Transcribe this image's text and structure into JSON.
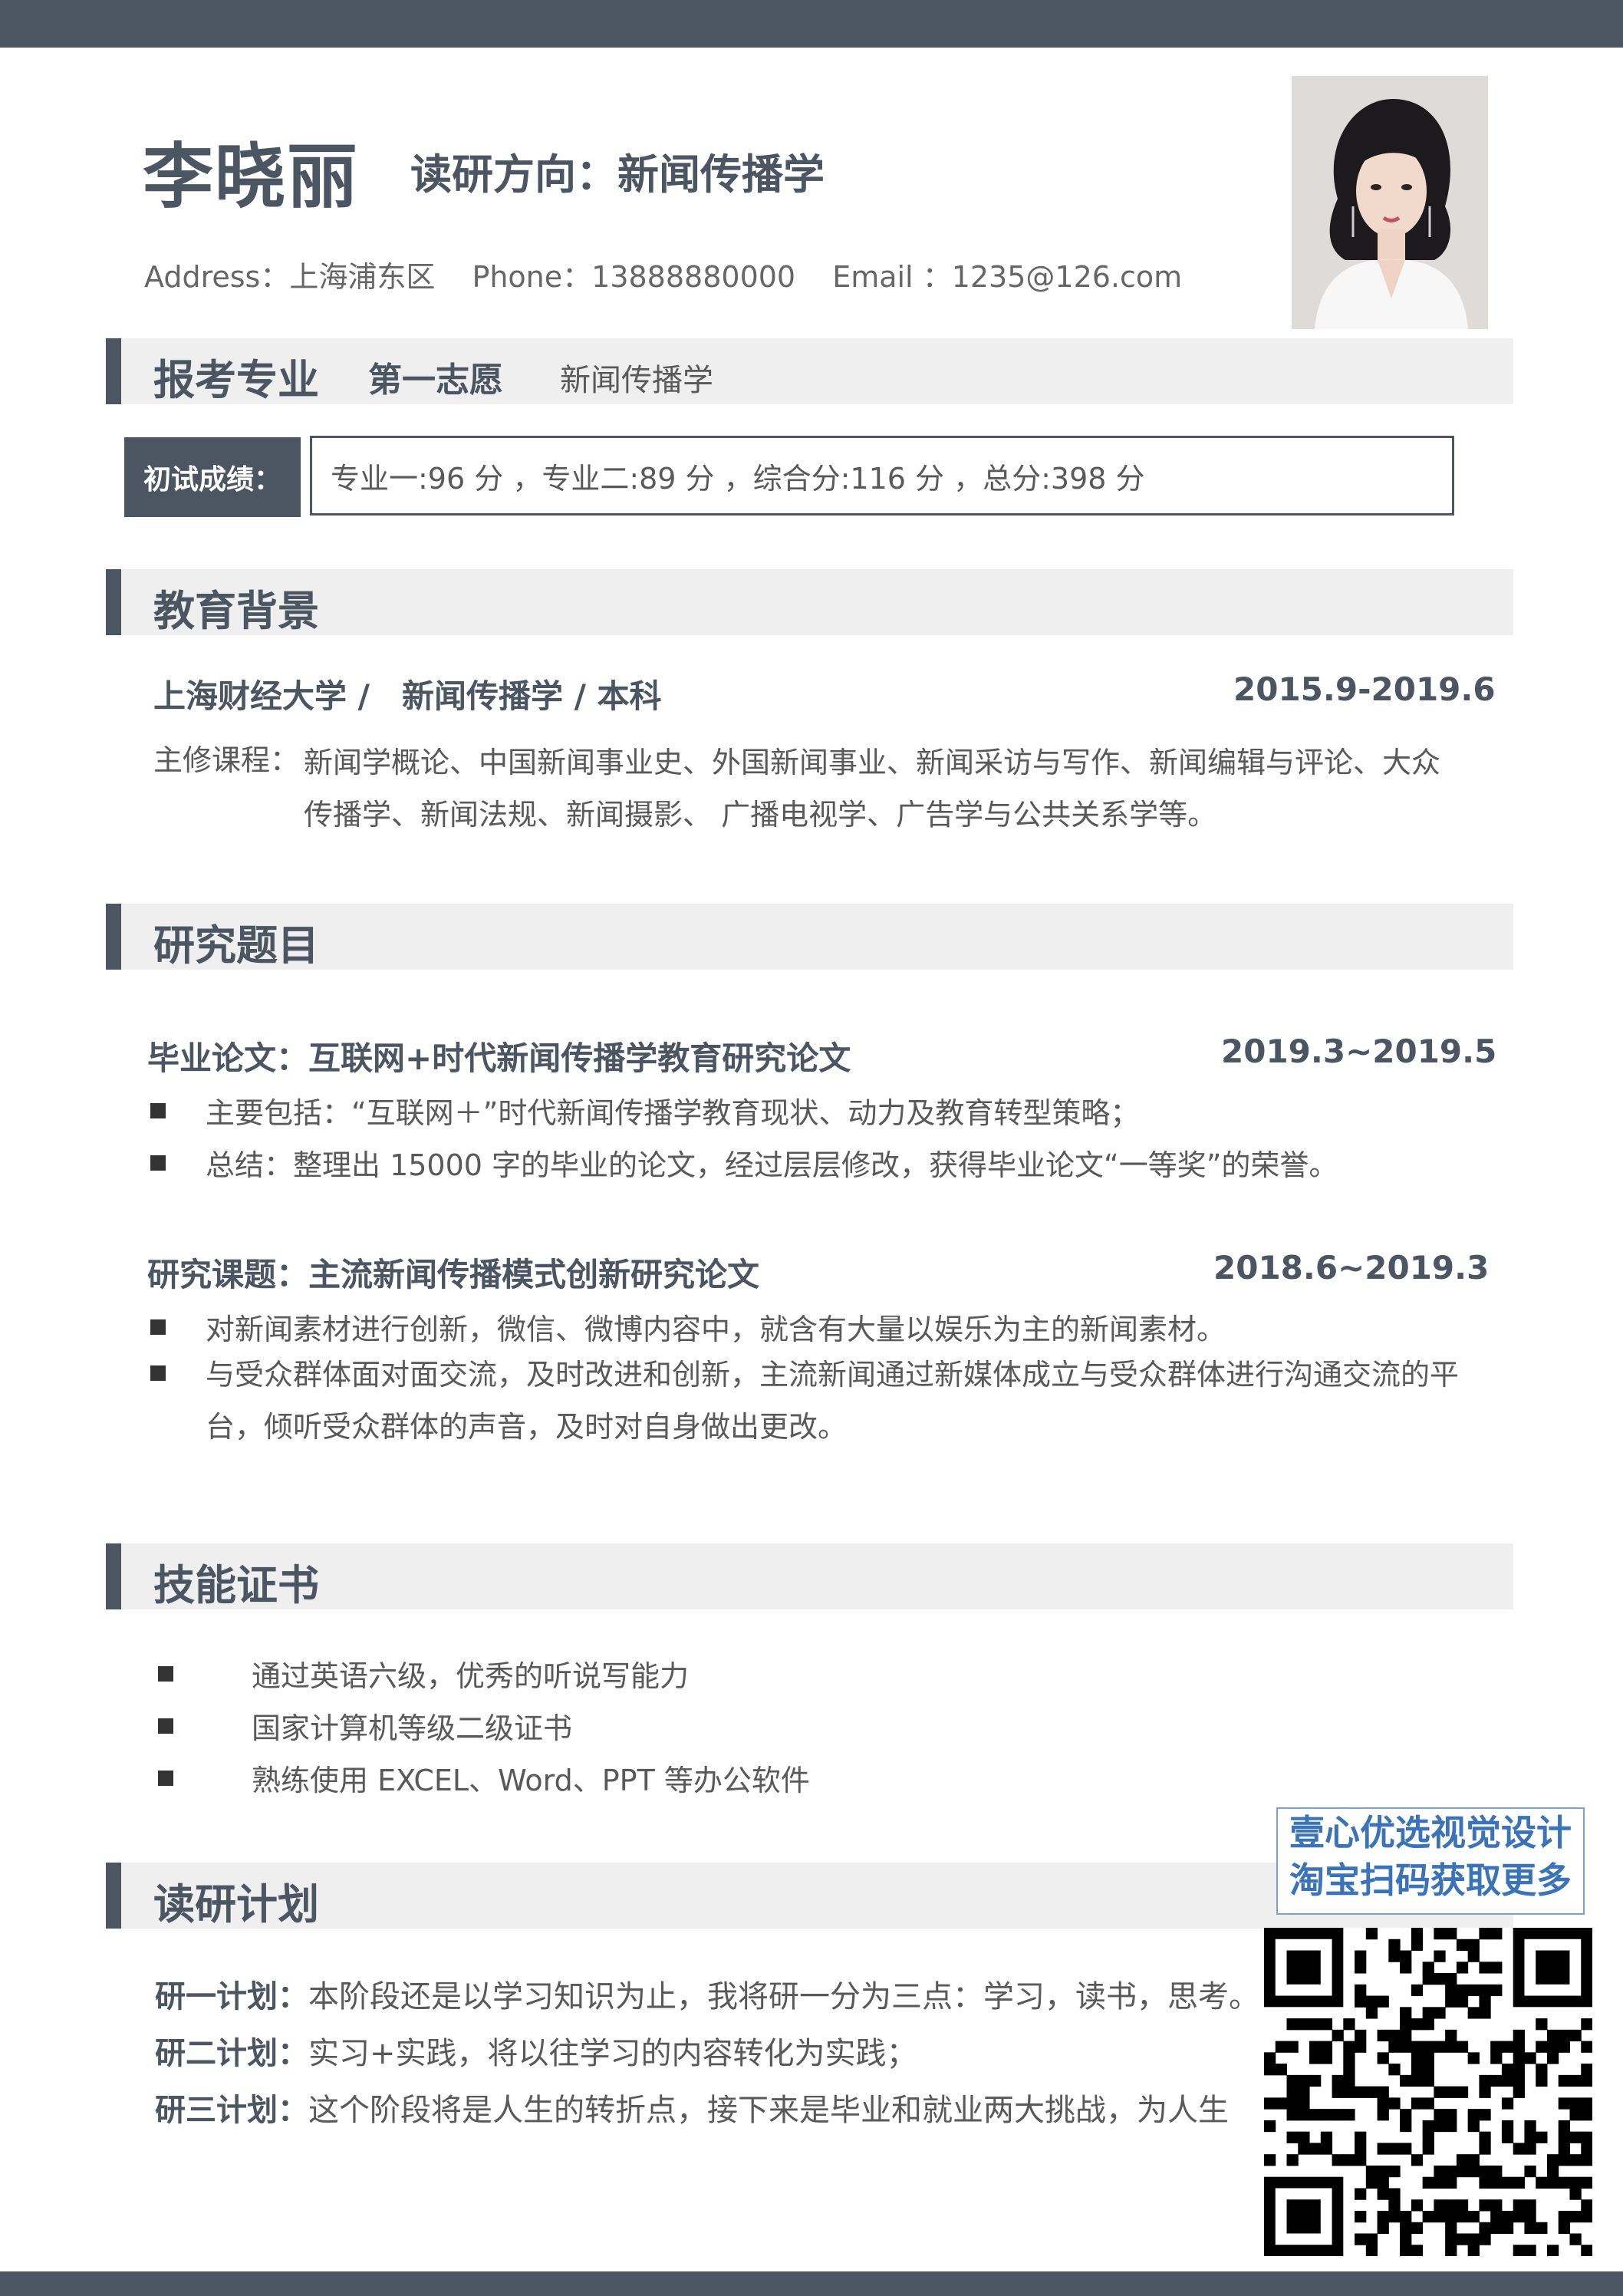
{
  "header": {
    "name": "李晓丽",
    "direction": "读研方向：新闻传播学",
    "address": "Address：上海浦东区",
    "phone": "Phone：13888880000",
    "email": "Email ：1235@126.com"
  },
  "apply": {
    "title": "报考专业",
    "choice_label": "第一志愿",
    "choice_value": "新闻传播学",
    "score_label": "初试成绩：",
    "score_text": "专业一:96 分 ，专业二:89 分 ，综合分:116 分 ，总分:398 分"
  },
  "education": {
    "title": "教育背景",
    "school_line": "上海财经大学 /　新闻传播学 / 本科",
    "date": "2015.9-2019.6",
    "courses_label": "主修课程：",
    "courses_line1": "新闻学概论、中国新闻事业史、外国新闻事业、新闻采访与写作、新闻编辑与评论、大众",
    "courses_line2": "传播学、新闻法规、新闻摄影、 广播电视学、广告学与公共关系学等。"
  },
  "research": {
    "title": "研究题目",
    "items": [
      {
        "title": "毕业论文：互联网+时代新闻传播学教育研究论文",
        "date": "2019.3~2019.5",
        "bullets": [
          "主要包括：“互联网＋”时代新闻传播学教育现状、动力及教育转型策略；",
          "总结：整理出 15000 字的毕业的论文，经过层层修改，获得毕业论文“一等奖”的荣誉。"
        ]
      },
      {
        "title": "研究课题：主流新闻传播模式创新研究论文",
        "date": "2018.6~2019.3",
        "bullets": [
          "对新闻素材进行创新，微信、微博内容中，就含有大量以娱乐为主的新闻素材。",
          "与受众群体面对面交流，及时改进和创新，主流新闻通过新媒体成立与受众群体进行沟通交流的平台，倾听受众群体的声音，及时对自身做出更改。"
        ]
      }
    ]
  },
  "skills": {
    "title": "技能证书",
    "items": [
      "通过英语六级，优秀的听说写能力",
      "国家计算机等级二级证书",
      "熟练使用 EXCEL、Word、PPT 等办公软件"
    ]
  },
  "plan": {
    "title": "读研计划",
    "items": [
      {
        "label": "研一计划：",
        "text": "本阶段还是以学习知识为止，我将研一分为三点：学习，读书，思考。"
      },
      {
        "label": "研二计划：",
        "text": "实习+实践，将以往学习的内容转化为实践；"
      },
      {
        "label": "研三计划：",
        "text": "这个阶段将是人生的转折点，接下来是毕业和就业两大挑战，为人生"
      }
    ]
  },
  "promo": {
    "line1": "壹心优选视觉设计",
    "line2": "淘宝扫码获取更多"
  },
  "colors": {
    "accent": "#4c5562",
    "section_bg": "#efefef",
    "promo_text": "#3b73b8"
  },
  "icons": [
    "bullet-square-icon",
    "qr-code-icon"
  ]
}
